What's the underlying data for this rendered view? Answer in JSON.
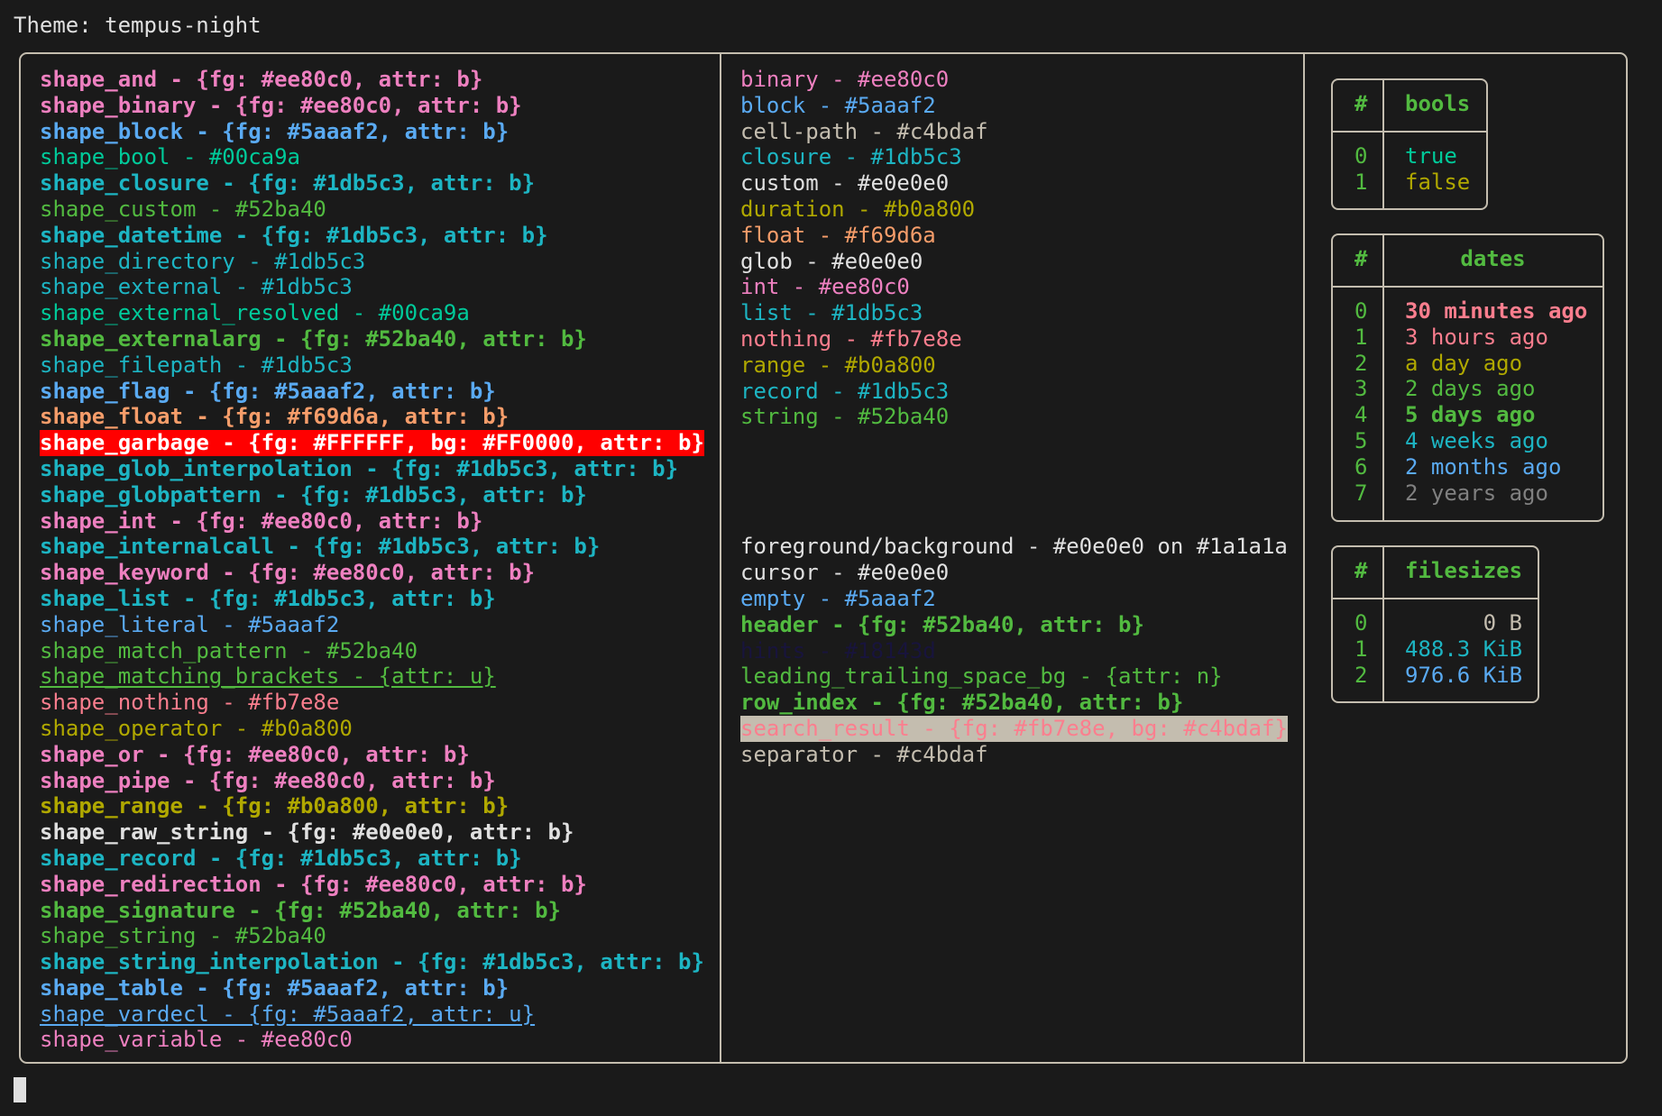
{
  "title": "Theme: tempus-night",
  "left_column": [
    {
      "text": "shape_and - {fg: #ee80c0, attr: b}",
      "fg": "#ee80c0",
      "bold": true
    },
    {
      "text": "shape_binary - {fg: #ee80c0, attr: b}",
      "fg": "#ee80c0",
      "bold": true
    },
    {
      "text": "shape_block - {fg: #5aaaf2, attr: b}",
      "fg": "#5aaaf2",
      "bold": true
    },
    {
      "text": "shape_bool - #00ca9a",
      "fg": "#00ca9a"
    },
    {
      "text": "shape_closure - {fg: #1db5c3, attr: b}",
      "fg": "#1db5c3",
      "bold": true
    },
    {
      "text": "shape_custom - #52ba40",
      "fg": "#52ba40"
    },
    {
      "text": "shape_datetime - {fg: #1db5c3, attr: b}",
      "fg": "#1db5c3",
      "bold": true
    },
    {
      "text": "shape_directory - #1db5c3",
      "fg": "#1db5c3"
    },
    {
      "text": "shape_external - #1db5c3",
      "fg": "#1db5c3"
    },
    {
      "text": "shape_external_resolved - #00ca9a",
      "fg": "#00ca9a"
    },
    {
      "text": "shape_externalarg - {fg: #52ba40, attr: b}",
      "fg": "#52ba40",
      "bold": true
    },
    {
      "text": "shape_filepath - #1db5c3",
      "fg": "#1db5c3"
    },
    {
      "text": "shape_flag - {fg: #5aaaf2, attr: b}",
      "fg": "#5aaaf2",
      "bold": true
    },
    {
      "text": "shape_float - {fg: #f69d6a, attr: b}",
      "fg": "#f69d6a",
      "bold": true
    },
    {
      "text": "shape_garbage - {fg: #FFFFFF, bg: #FF0000, attr: b}",
      "fg": "#FFFFFF",
      "bg": "#FF0000",
      "bold": true
    },
    {
      "text": "shape_glob_interpolation - {fg: #1db5c3, attr: b}",
      "fg": "#1db5c3",
      "bold": true
    },
    {
      "text": "shape_globpattern - {fg: #1db5c3, attr: b}",
      "fg": "#1db5c3",
      "bold": true
    },
    {
      "text": "shape_int - {fg: #ee80c0, attr: b}",
      "fg": "#ee80c0",
      "bold": true
    },
    {
      "text": "shape_internalcall - {fg: #1db5c3, attr: b}",
      "fg": "#1db5c3",
      "bold": true
    },
    {
      "text": "shape_keyword - {fg: #ee80c0, attr: b}",
      "fg": "#ee80c0",
      "bold": true
    },
    {
      "text": "shape_list - {fg: #1db5c3, attr: b}",
      "fg": "#1db5c3",
      "bold": true
    },
    {
      "text": "shape_literal - #5aaaf2",
      "fg": "#5aaaf2"
    },
    {
      "text": "shape_match_pattern - #52ba40",
      "fg": "#52ba40"
    },
    {
      "text": "shape_matching_brackets - {attr: u}",
      "fg": "#52ba40",
      "underline": true
    },
    {
      "text": "shape_nothing - #fb7e8e",
      "fg": "#fb7e8e"
    },
    {
      "text": "shape_operator - #b0a800",
      "fg": "#b0a800"
    },
    {
      "text": "shape_or - {fg: #ee80c0, attr: b}",
      "fg": "#ee80c0",
      "bold": true
    },
    {
      "text": "shape_pipe - {fg: #ee80c0, attr: b}",
      "fg": "#ee80c0",
      "bold": true
    },
    {
      "text": "shape_range - {fg: #b0a800, attr: b}",
      "fg": "#b0a800",
      "bold": true
    },
    {
      "text": "shape_raw_string - {fg: #e0e0e0, attr: b}",
      "fg": "#e0e0e0",
      "bold": true
    },
    {
      "text": "shape_record - {fg: #1db5c3, attr: b}",
      "fg": "#1db5c3",
      "bold": true
    },
    {
      "text": "shape_redirection - {fg: #ee80c0, attr: b}",
      "fg": "#ee80c0",
      "bold": true
    },
    {
      "text": "shape_signature - {fg: #52ba40, attr: b}",
      "fg": "#52ba40",
      "bold": true
    },
    {
      "text": "shape_string - #52ba40",
      "fg": "#52ba40"
    },
    {
      "text": "shape_string_interpolation - {fg: #1db5c3, attr: b}",
      "fg": "#1db5c3",
      "bold": true
    },
    {
      "text": "shape_table - {fg: #5aaaf2, attr: b}",
      "fg": "#5aaaf2",
      "bold": true
    },
    {
      "text": "shape_vardecl - {fg: #5aaaf2, attr: u}",
      "fg": "#5aaaf2",
      "underline": true
    },
    {
      "text": "shape_variable - #ee80c0",
      "fg": "#ee80c0"
    }
  ],
  "middle_column": [
    {
      "text": "binary - #ee80c0",
      "fg": "#ee80c0"
    },
    {
      "text": "block - #5aaaf2",
      "fg": "#5aaaf2"
    },
    {
      "text": "cell-path - #c4bdaf",
      "fg": "#c4bdaf"
    },
    {
      "text": "closure - #1db5c3",
      "fg": "#1db5c3"
    },
    {
      "text": "custom - #e0e0e0",
      "fg": "#e0e0e0"
    },
    {
      "text": "duration - #b0a800",
      "fg": "#b0a800"
    },
    {
      "text": "float - #f69d6a",
      "fg": "#f69d6a"
    },
    {
      "text": "glob - #e0e0e0",
      "fg": "#e0e0e0"
    },
    {
      "text": "int - #ee80c0",
      "fg": "#ee80c0"
    },
    {
      "text": "list - #1db5c3",
      "fg": "#1db5c3"
    },
    {
      "text": "nothing - #fb7e8e",
      "fg": "#fb7e8e"
    },
    {
      "text": "range - #b0a800",
      "fg": "#b0a800"
    },
    {
      "text": "record - #1db5c3",
      "fg": "#1db5c3"
    },
    {
      "text": "string - #52ba40",
      "fg": "#52ba40"
    },
    {
      "text": "",
      "fg": "#e0e0e0"
    },
    {
      "text": "",
      "fg": "#e0e0e0"
    },
    {
      "text": "",
      "fg": "#e0e0e0"
    },
    {
      "text": "",
      "fg": "#e0e0e0"
    },
    {
      "text": "foreground/background - #e0e0e0 on #1a1a1a",
      "fg": "#e0e0e0"
    },
    {
      "text": "cursor - #e0e0e0",
      "fg": "#e0e0e0"
    },
    {
      "text": "empty - #5aaaf2",
      "fg": "#5aaaf2"
    },
    {
      "text": "header - {fg: #52ba40, attr: b}",
      "fg": "#52ba40",
      "bold": true
    },
    {
      "text": "hints - #18143d",
      "fg": "#18143d"
    },
    {
      "text": "leading_trailing_space_bg - {attr: n}",
      "fg": "#52ba40"
    },
    {
      "text": "row_index - {fg: #52ba40, attr: b}",
      "fg": "#52ba40",
      "bold": true
    },
    {
      "text": "search_result - {fg: #fb7e8e, bg: #c4bdaf}",
      "fg": "#fb7e8e",
      "bg": "#c4bdaf"
    },
    {
      "text": "separator - #c4bdaf",
      "fg": "#c4bdaf"
    }
  ],
  "tables": {
    "bools": {
      "index_header": "#",
      "header": "bools",
      "rows": [
        {
          "index": "0",
          "value": "true",
          "fg": "#00ca9a"
        },
        {
          "index": "1",
          "value": "false",
          "fg": "#b0a800"
        }
      ]
    },
    "dates": {
      "index_header": "#",
      "header": "dates",
      "rows": [
        {
          "index": "0",
          "value": "30 minutes ago",
          "fg": "#fb7e8e",
          "bold": true
        },
        {
          "index": "1",
          "value": "3 hours ago",
          "fg": "#fb7e8e"
        },
        {
          "index": "2",
          "value": "a day ago",
          "fg": "#b0a800"
        },
        {
          "index": "3",
          "value": "2 days ago",
          "fg": "#52ba40"
        },
        {
          "index": "4",
          "value": "5 days ago",
          "fg": "#52ba40",
          "bold": true
        },
        {
          "index": "5",
          "value": "4 weeks ago",
          "fg": "#1db5c3"
        },
        {
          "index": "6",
          "value": "2 months ago",
          "fg": "#5aaaf2"
        },
        {
          "index": "7",
          "value": "2 years ago",
          "fg": "#808080"
        }
      ]
    },
    "filesizes": {
      "index_header": "#",
      "header": "filesizes",
      "rows": [
        {
          "index": "0",
          "value": "0 B",
          "fg": "#c4bdaf"
        },
        {
          "index": "1",
          "value": "488.3 KiB",
          "fg": "#1db5c3"
        },
        {
          "index": "2",
          "value": "976.6 KiB",
          "fg": "#5aaaf2"
        }
      ]
    }
  },
  "colors": {
    "background": "#1a1a1a",
    "foreground": "#e0e0e0",
    "separator": "#c4bdaf",
    "header": "#52ba40",
    "row_index": "#52ba40"
  }
}
